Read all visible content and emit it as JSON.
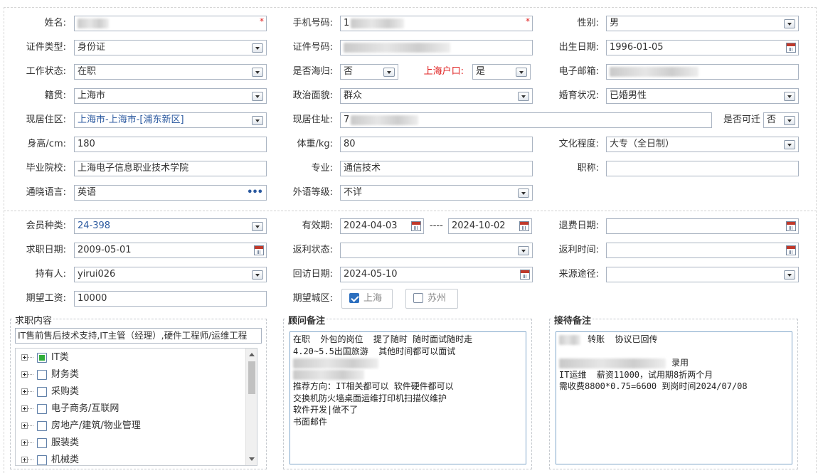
{
  "profile": {
    "name": {
      "label": "姓名:",
      "required": "*"
    },
    "phone": {
      "label": "手机号码:",
      "value_prefix": "1",
      "required": "*"
    },
    "gender": {
      "label": "性别:",
      "value": "男"
    },
    "id_type": {
      "label": "证件类型:",
      "value": "身份证"
    },
    "id_number": {
      "label": "证件号码:"
    },
    "birth_date": {
      "label": "出生日期:",
      "value": "1996-01-05"
    },
    "work_status": {
      "label": "工作状态:",
      "value": "在职"
    },
    "overseas_return": {
      "label": "是否海归:",
      "value": "否"
    },
    "shanghai_hukou": {
      "label": "上海户口:",
      "value": "是"
    },
    "email": {
      "label": "电子邮箱:"
    },
    "native_place": {
      "label": "籍贯:",
      "value": "上海市"
    },
    "political_status": {
      "label": "政治面貌:",
      "value": "群众"
    },
    "marital_status": {
      "label": "婚育状况:",
      "value": "已婚男性"
    },
    "residence_area": {
      "label": "现居住区:",
      "value": "上海市-上海市-[浦东新区]"
    },
    "residence_address": {
      "label": "现居住址:",
      "value_prefix": "7"
    },
    "can_relocate": {
      "label": "是否可迁",
      "value": "否"
    },
    "height": {
      "label": "身高/cm:",
      "value": "180"
    },
    "weight": {
      "label": "体重/kg:",
      "value": "80"
    },
    "education": {
      "label": "文化程度:",
      "value": "大专（全日制）"
    },
    "school": {
      "label": "毕业院校:",
      "value": "上海电子信息职业技术学院"
    },
    "major": {
      "label": "专业:",
      "value": "通信技术"
    },
    "title": {
      "label": "职称:",
      "value": ""
    },
    "language": {
      "label": "通晓语言:",
      "value": "英语",
      "more": "•••"
    },
    "foreign_level": {
      "label": "外语等级:",
      "value": "不详"
    }
  },
  "membership": {
    "member_type": {
      "label": "会员种类:",
      "value": "24-398"
    },
    "validity": {
      "label": "有效期:",
      "start": "2024-04-03",
      "separator": "----",
      "end": "2024-10-02"
    },
    "refund_date": {
      "label": "退费日期:",
      "value": ""
    },
    "job_seek_date": {
      "label": "求职日期:",
      "value": "2009-05-01"
    },
    "rebate_status": {
      "label": "返利状态:",
      "value": ""
    },
    "rebate_time": {
      "label": "返利时间:",
      "value": ""
    },
    "holder": {
      "label": "持有人:",
      "value": "yirui026"
    },
    "visit_date": {
      "label": "回访日期:",
      "value": "2024-05-10"
    },
    "source": {
      "label": "来源途径:",
      "value": ""
    },
    "expected_salary": {
      "label": "期望工资:",
      "value": "10000"
    },
    "expected_city": {
      "label": "期望城区:",
      "options": [
        {
          "label": "上海",
          "checked": true
        },
        {
          "label": "苏州",
          "checked": false
        }
      ]
    }
  },
  "job_content": {
    "title": "求职内容",
    "summary": "IT售前售后技术支持,IT主管（经理）,硬件工程师/运维工程",
    "tree": [
      {
        "label": "IT类",
        "state": "partial"
      },
      {
        "label": "财务类",
        "state": "none"
      },
      {
        "label": "采购类",
        "state": "none"
      },
      {
        "label": "电子商务/互联网",
        "state": "none"
      },
      {
        "label": "房地产/建筑/物业管理",
        "state": "none"
      },
      {
        "label": "服装类",
        "state": "none"
      },
      {
        "label": "机械类",
        "state": "none"
      }
    ]
  },
  "advisor_notes": {
    "title": "顾问备注",
    "lines": [
      "在职  外包的岗位  提了随时 随时面试随时走",
      "4.20~5.5出国旅游  其他时间都可以面试",
      "",
      "",
      "推荐方向：IT相关都可以 软件硬件都可以",
      "交换机防火墙桌面运维打印机扫描仪维护",
      "软件开发|做不了",
      "书面邮件"
    ]
  },
  "reception_notes": {
    "title": "接待备注",
    "lines": [
      "转账  协议已回传",
      "",
      "录用",
      "IT运维  薪资11000，试用期8折两个月",
      "需收费8800*0.75=6600 到岗时间2024/07/08"
    ]
  },
  "colors": {
    "accent": "#2c6fbf",
    "required": "#e02020",
    "border": "#aab4c2"
  }
}
